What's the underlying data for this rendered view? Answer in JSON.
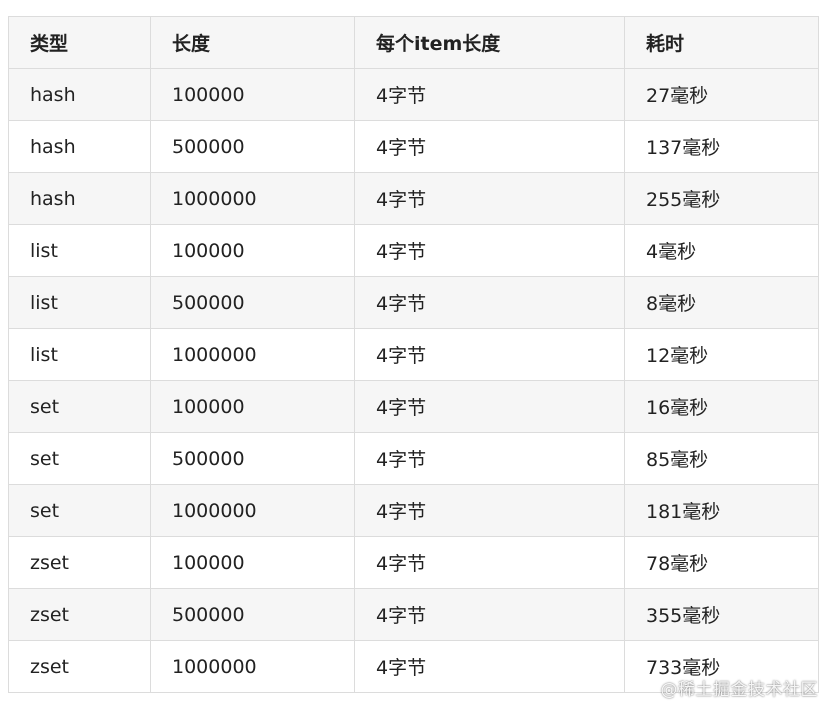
{
  "table": {
    "headers": [
      "类型",
      "长度",
      "每个item长度",
      "耗时"
    ],
    "rows": [
      [
        "hash",
        "100000",
        "4字节",
        "27毫秒"
      ],
      [
        "hash",
        "500000",
        "4字节",
        "137毫秒"
      ],
      [
        "hash",
        "1000000",
        "4字节",
        "255毫秒"
      ],
      [
        "list",
        "100000",
        "4字节",
        "4毫秒"
      ],
      [
        "list",
        "500000",
        "4字节",
        "8毫秒"
      ],
      [
        "list",
        "1000000",
        "4字节",
        "12毫秒"
      ],
      [
        "set",
        "100000",
        "4字节",
        "16毫秒"
      ],
      [
        "set",
        "500000",
        "4字节",
        "85毫秒"
      ],
      [
        "set",
        "1000000",
        "4字节",
        "181毫秒"
      ],
      [
        "zset",
        "100000",
        "4字节",
        "78毫秒"
      ],
      [
        "zset",
        "500000",
        "4字节",
        "355毫秒"
      ],
      [
        "zset",
        "1000000",
        "4字节",
        "733毫秒"
      ]
    ]
  },
  "watermark": "@稀土掘金技术社区"
}
